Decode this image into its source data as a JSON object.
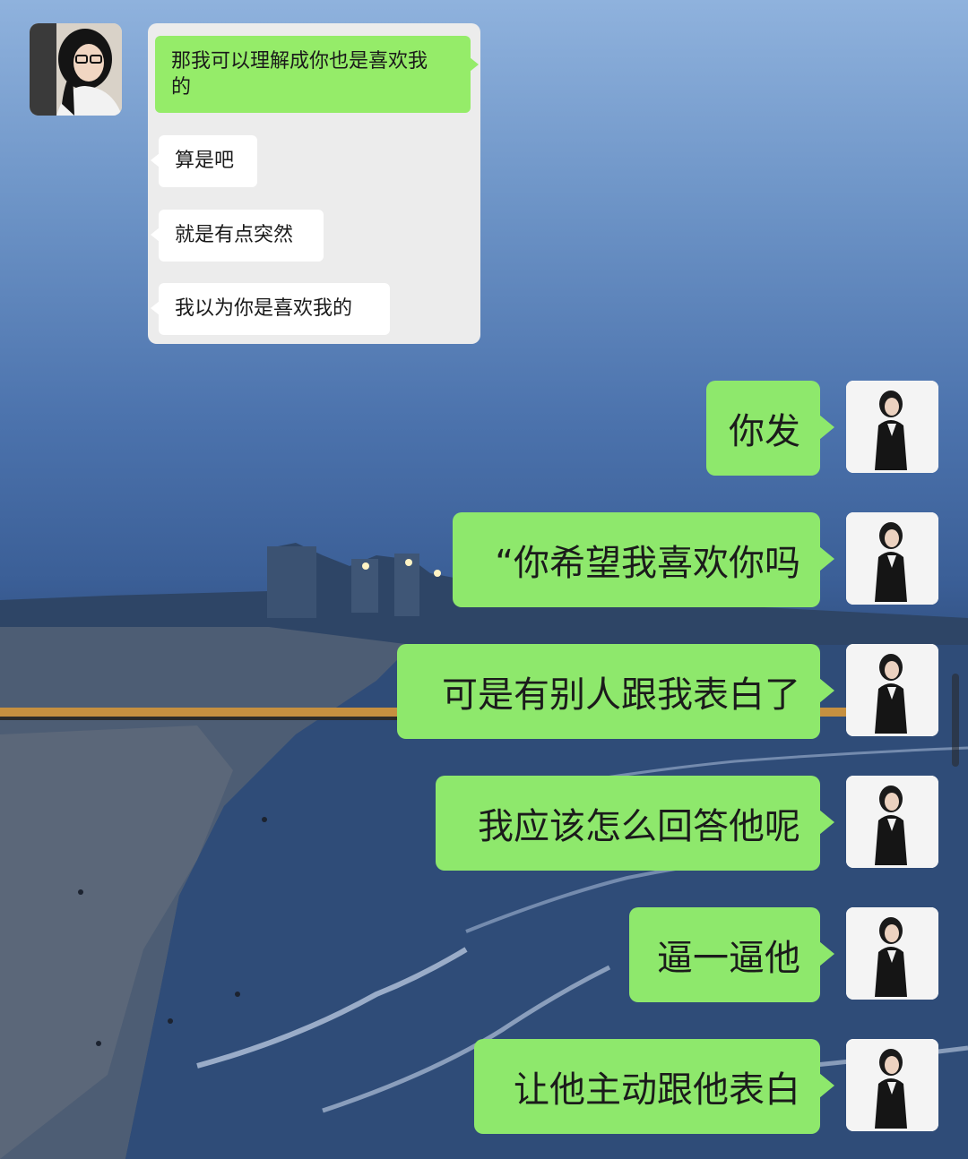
{
  "quoted_chat": {
    "messages": [
      {
        "side": "outgoing",
        "text": "那我可以理解成你也是喜欢我的",
        "line1": "那我可以理解成你也是喜欢我",
        "line2": "的"
      },
      {
        "side": "incoming",
        "text": "算是吧"
      },
      {
        "side": "incoming",
        "text": "就是有点突然"
      },
      {
        "side": "incoming",
        "text": "我以为你是喜欢我的"
      }
    ]
  },
  "chat": {
    "messages": [
      {
        "side": "outgoing",
        "text": "你发"
      },
      {
        "side": "outgoing",
        "text": "“你希望我喜欢你吗"
      },
      {
        "side": "outgoing",
        "text": "可是有别人跟我表白了"
      },
      {
        "side": "outgoing",
        "text": "我应该怎么回答他呢"
      },
      {
        "side": "outgoing",
        "text": "逼一逼他"
      },
      {
        "side": "outgoing",
        "text": "让他主动跟他表白"
      }
    ]
  },
  "colors": {
    "outgoing_bubble": "#95ec69",
    "incoming_bubble": "#ffffff",
    "card_background": "#ececec"
  },
  "icons": {
    "left_avatar": "woman-with-glasses-avatar",
    "right_avatar": "woman-in-black-suit-avatar"
  }
}
